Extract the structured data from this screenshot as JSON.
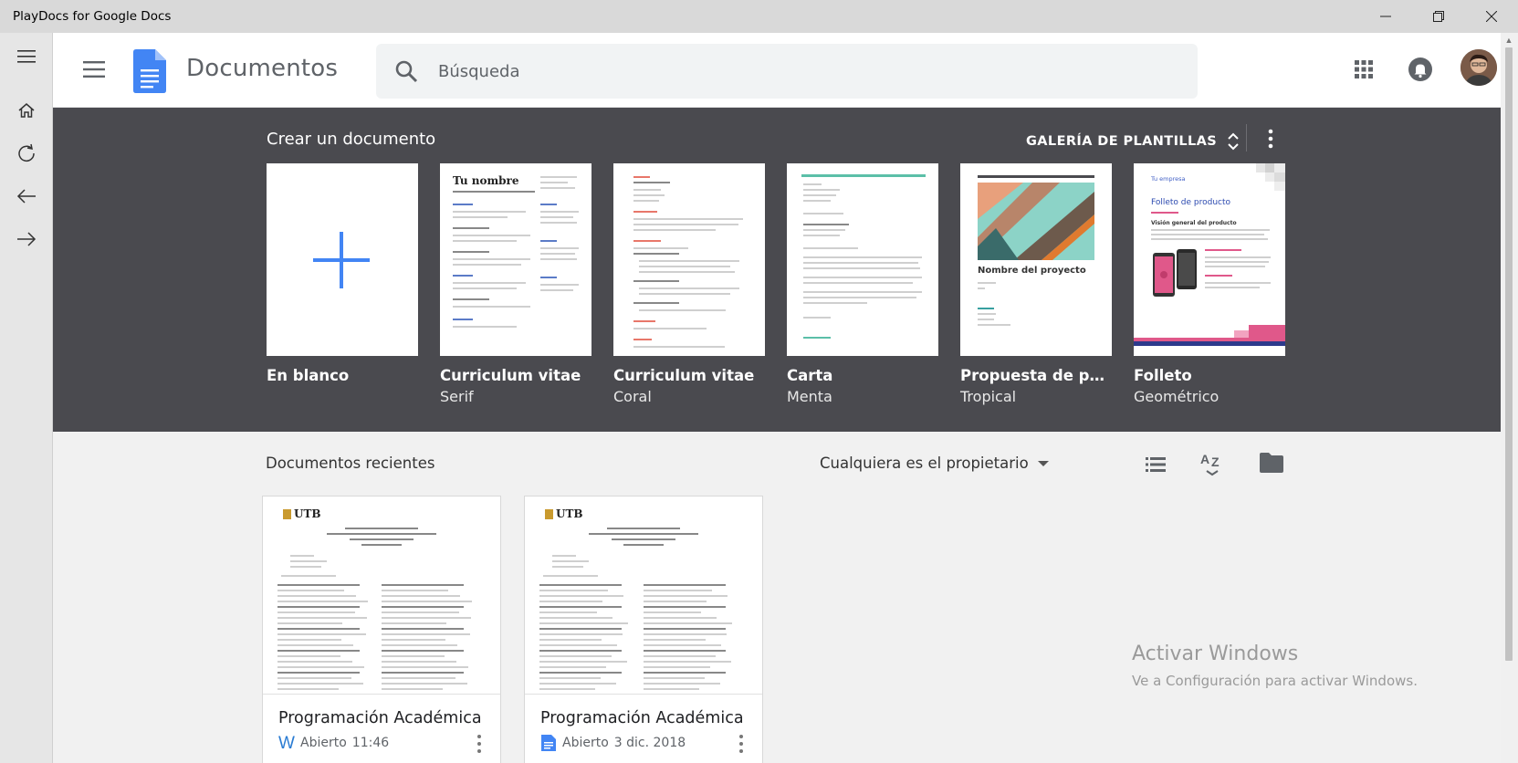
{
  "window": {
    "title": "PlayDocs for Google Docs",
    "controls": [
      "minimize-icon",
      "restore-icon",
      "close-icon"
    ]
  },
  "leftbar": {
    "items": [
      {
        "icon": "menu-icon",
        "label": "Menu"
      },
      {
        "icon": "home-icon",
        "label": "Home"
      },
      {
        "icon": "refresh-icon",
        "label": "Refresh"
      },
      {
        "icon": "arrow-left-icon",
        "label": "Back"
      },
      {
        "icon": "arrow-right-icon",
        "label": "Forward"
      }
    ]
  },
  "header": {
    "app_title": "Documentos",
    "search_placeholder": "Búsqueda"
  },
  "colors": {
    "docs_blue": "#4285f4",
    "band": "#4a4a4f",
    "header_bg": "#ffffff",
    "body_bg": "#f1f1f1"
  },
  "templates": {
    "heading": "Crear un documento",
    "gallery_label": "GALERÍA DE PLANTILLAS",
    "items": [
      {
        "name": "En blanco",
        "subtitle": ""
      },
      {
        "name": "Curriculum vitae",
        "subtitle": "Serif",
        "thumb_title": "Tu nombre"
      },
      {
        "name": "Curriculum vitae",
        "subtitle": "Coral"
      },
      {
        "name": "Carta",
        "subtitle": "Menta"
      },
      {
        "name": "Propuesta de proyecto",
        "subtitle": "Tropical",
        "thumb_title": "Nombre del proyecto"
      },
      {
        "name": "Folleto",
        "subtitle": "Geométrico",
        "thumb_company": "Tu empresa",
        "thumb_title": "Folleto de producto",
        "thumb_section": "Visión general del producto"
      }
    ]
  },
  "recent": {
    "heading": "Documentos recientes",
    "owner_filter": "Cualquiera es el propietario",
    "docs": [
      {
        "title": "Programación Académica",
        "status": "Abierto",
        "time": "11:46",
        "file_icon": "word-icon",
        "logo": "UTB"
      },
      {
        "title": "Programación Académica",
        "status": "Abierto",
        "time": "3 dic. 2018",
        "file_icon": "docs-icon",
        "logo": "UTB"
      }
    ]
  },
  "watermark": {
    "line1": "Activar Windows",
    "line2": "Ve a Configuración para activar Windows."
  }
}
